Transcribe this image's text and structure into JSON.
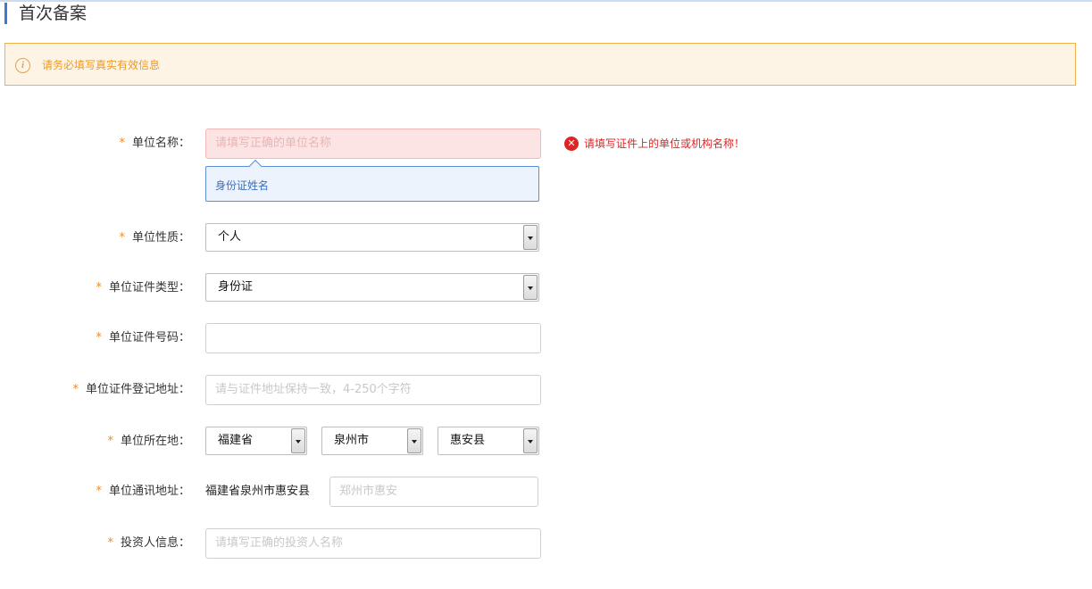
{
  "page": {
    "title": "首次备案"
  },
  "notice": {
    "text": "请务必填写真实有效信息"
  },
  "form": {
    "unit_name": {
      "label": "单位名称：",
      "placeholder": "请填写正确的单位名称",
      "suggestion": "身份证姓名",
      "error": "请填写证件上的单位或机构名称！"
    },
    "unit_nature": {
      "label": "单位性质：",
      "value": "个人"
    },
    "cert_type": {
      "label": "单位证件类型：",
      "value": "身份证"
    },
    "cert_number": {
      "label": "单位证件号码：",
      "value": ""
    },
    "cert_address": {
      "label": "单位证件登记地址：",
      "placeholder": "请与证件地址保持一致，4-250个字符"
    },
    "location": {
      "label": "单位所在地：",
      "province": "福建省",
      "city": "泉州市",
      "county": "惠安县"
    },
    "mail_address": {
      "label": "单位通讯地址：",
      "prefix": "福建省泉州市惠安县",
      "placeholder": "郑州市惠安"
    },
    "investor": {
      "label": "投资人信息：",
      "placeholder": "请填写正确的投资人名称"
    },
    "required_mark": "*"
  },
  "colors": {
    "accent": "#3b78d8",
    "warning": "#f0a030",
    "error": "#e02424",
    "required": "#f08a24"
  }
}
